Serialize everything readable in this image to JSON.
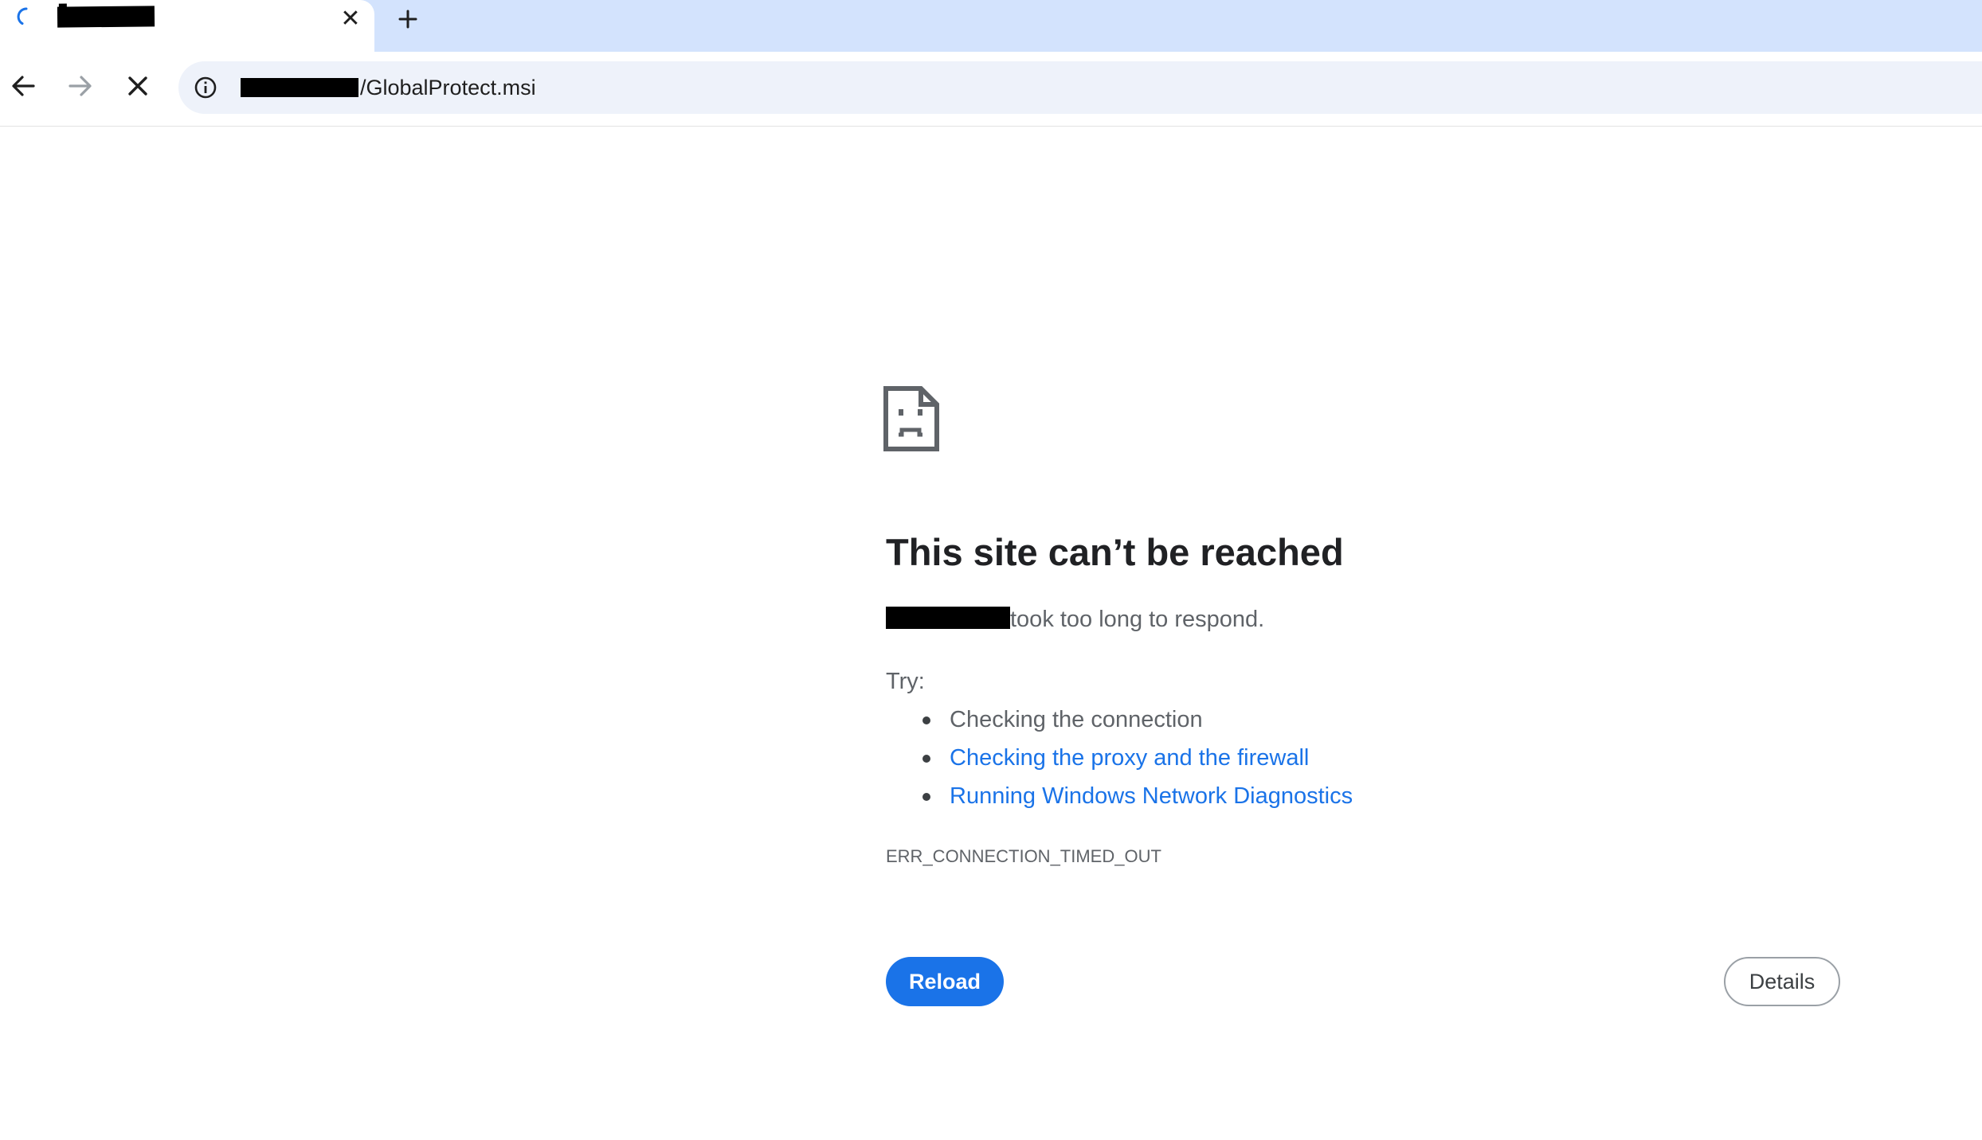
{
  "browser": {
    "tab": {
      "close_symbol": "✕",
      "status": "loading"
    },
    "toolbar": {
      "back_icon": "arrow-left",
      "forward_icon": "arrow-right",
      "stop_icon": "x"
    },
    "omnibox": {
      "url_path": "/GlobalProtect.msi"
    }
  },
  "error_page": {
    "title": "This site can’t be reached",
    "subtitle_suffix": "took too long to respond.",
    "try_label": "Try:",
    "suggestions": [
      {
        "text": "Checking the connection",
        "is_link": false
      },
      {
        "text": "Checking the proxy and the firewall",
        "is_link": true
      },
      {
        "text": "Running Windows Network Diagnostics",
        "is_link": true
      }
    ],
    "error_code": "ERR_CONNECTION_TIMED_OUT",
    "reload_label": "Reload",
    "details_label": "Details"
  },
  "colors": {
    "tabstrip_bg": "#d3e3fd",
    "omnibox_bg": "#eef2fa",
    "link": "#1a73e8",
    "primary_button": "#1a73e8",
    "title_text": "#202124",
    "body_text": "#5f6368"
  }
}
